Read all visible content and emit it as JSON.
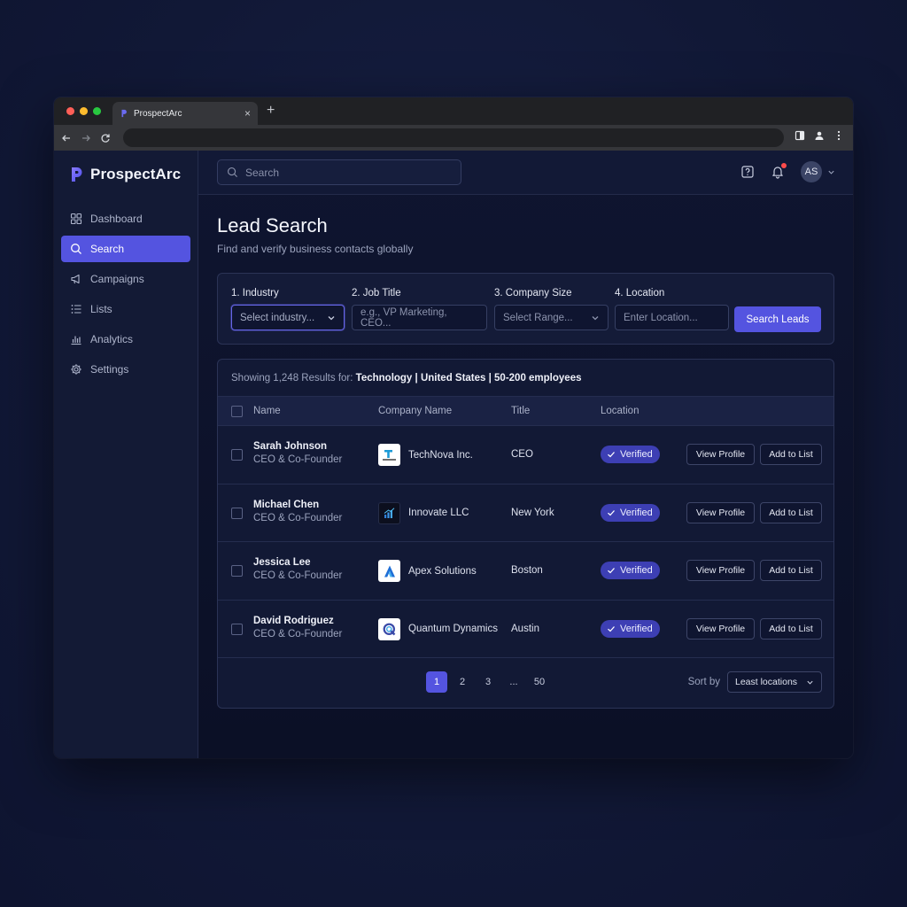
{
  "browser": {
    "tab_title": "ProspectArc",
    "tab_close": "×",
    "new_tab": "+"
  },
  "brand": {
    "name": "ProspectArc"
  },
  "sidebar": {
    "items": [
      {
        "label": "Dashboard",
        "icon": "grid-icon",
        "active": false
      },
      {
        "label": "Search",
        "icon": "search-icon",
        "active": true
      },
      {
        "label": "Campaigns",
        "icon": "megaphone-icon",
        "active": false
      },
      {
        "label": "Lists",
        "icon": "list-icon",
        "active": false
      },
      {
        "label": "Analytics",
        "icon": "bar-chart-icon",
        "active": false
      },
      {
        "label": "Settings",
        "icon": "gear-icon",
        "active": false
      }
    ]
  },
  "topbar": {
    "search_placeholder": "Search",
    "avatar_initials": "AS"
  },
  "page": {
    "title": "Lead Search",
    "subtitle": "Find and verify business contacts globally"
  },
  "filters": {
    "industry": {
      "label": "1. Industry",
      "placeholder": "Select industry..."
    },
    "job_title": {
      "label": "2. Job Title",
      "placeholder": "e.g., VP Marketing, CEO..."
    },
    "company_size": {
      "label": "3. Company Size",
      "placeholder": "Select Range..."
    },
    "location": {
      "label": "4. Location",
      "placeholder": "Enter Location..."
    },
    "search_button": "Search Leads"
  },
  "results": {
    "summary_prefix": "Showing 1,248 Results for:",
    "summary_terms": "Technology | United States | 50-200 employees",
    "columns": {
      "name": "Name",
      "company": "Company Name",
      "title": "Title",
      "location": "Location"
    },
    "rows": [
      {
        "name": "Sarah Johnson",
        "role": "CEO & Co-Founder",
        "company": "TechNova Inc.",
        "title": "CEO",
        "status": "Verified"
      },
      {
        "name": "Michael Chen",
        "role": "CEO & Co-Founder",
        "company": "Innovate LLC",
        "title": "New York",
        "status": "Verified"
      },
      {
        "name": "Jessica Lee",
        "role": "CEO & Co-Founder",
        "company": "Apex Solutions",
        "title": "Boston",
        "status": "Verified"
      },
      {
        "name": "David Rodriguez",
        "role": "CEO & Co-Founder",
        "company": "Quantum Dynamics",
        "title": "Austin",
        "status": "Verified"
      }
    ],
    "view_profile_label": "View Profile",
    "add_to_list_label": "Add to List"
  },
  "pagination": {
    "pages": [
      "1",
      "2",
      "3",
      "...",
      "50"
    ],
    "current": "1",
    "sort_label": "Sort by",
    "sort_value": "Least locations"
  },
  "colors": {
    "accent": "#5454e0",
    "background": "#111836",
    "verified_badge": "#3d3fb4"
  }
}
